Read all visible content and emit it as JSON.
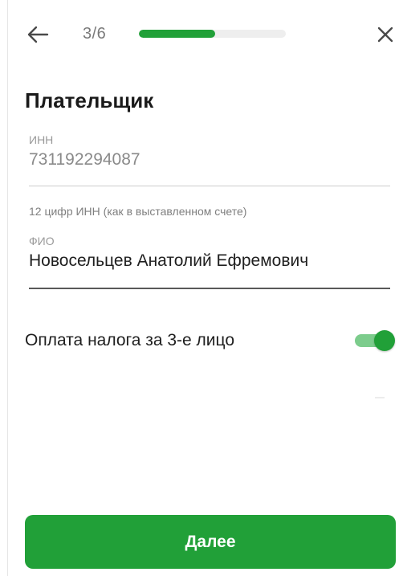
{
  "header": {
    "back_icon": "arrow-left-icon",
    "step_text": "3/6",
    "progress": {
      "current": 3,
      "total": 6,
      "fraction": 0.52
    },
    "close_icon": "close-icon"
  },
  "form": {
    "title": "Плательщик",
    "inn": {
      "label": "ИНН",
      "value": "731192294087",
      "helper": "12 цифр ИНН (как в выставленном счете)"
    },
    "fio": {
      "label": "ФИО",
      "value": "Новосельцев Анатолий Ефремович"
    },
    "third_party_toggle": {
      "label": "Оплата налога за 3-е лицо",
      "checked": true
    }
  },
  "footer": {
    "next_label": "Далее"
  },
  "colors": {
    "accent": "#21a038",
    "accent_light": "#7ccc8c",
    "muted_text": "#8a8a8a",
    "track": "#eeeeee"
  }
}
